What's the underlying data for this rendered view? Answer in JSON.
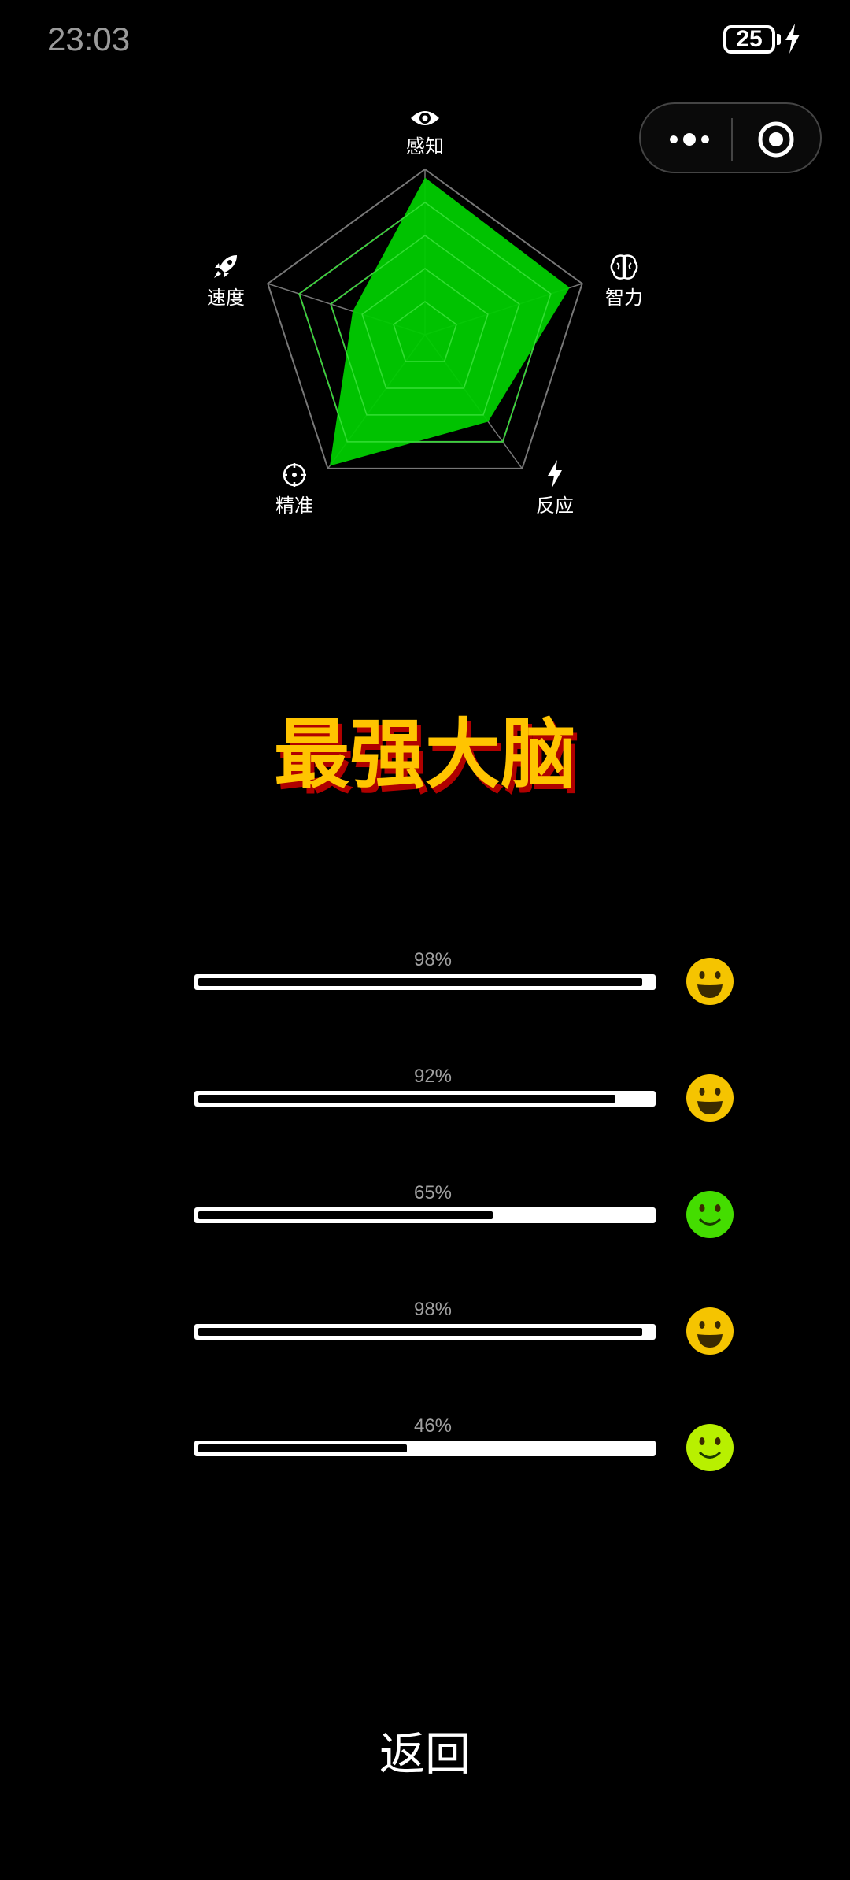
{
  "status_bar": {
    "time": "23:03",
    "battery": "25"
  },
  "radar": {
    "axes": [
      {
        "label": "感知",
        "icon": "eye-icon",
        "value": 0.95
      },
      {
        "label": "智力",
        "icon": "brain-icon",
        "value": 0.92
      },
      {
        "label": "反应",
        "icon": "lightning-icon",
        "value": 0.65
      },
      {
        "label": "精准",
        "icon": "crosshair-icon",
        "value": 0.98
      },
      {
        "label": "速度",
        "icon": "rocket-icon",
        "value": 0.46
      }
    ],
    "fill_color": "#00cc00",
    "grid_color": "#777777"
  },
  "title": "最强大脑",
  "bars": [
    {
      "percent_label": "98%",
      "value": 0.98,
      "face": "grin-face-icon",
      "face_color": "#f5c400"
    },
    {
      "percent_label": "92%",
      "value": 0.92,
      "face": "grin-face-icon",
      "face_color": "#f5c400"
    },
    {
      "percent_label": "65%",
      "value": 0.65,
      "face": "smile-face-icon",
      "face_color": "#44dd00"
    },
    {
      "percent_label": "98%",
      "value": 0.98,
      "face": "grin-face-icon",
      "face_color": "#f5c400"
    },
    {
      "percent_label": "46%",
      "value": 0.46,
      "face": "smile-face-icon",
      "face_color": "#b8f000"
    }
  ],
  "back_label": "返回"
}
